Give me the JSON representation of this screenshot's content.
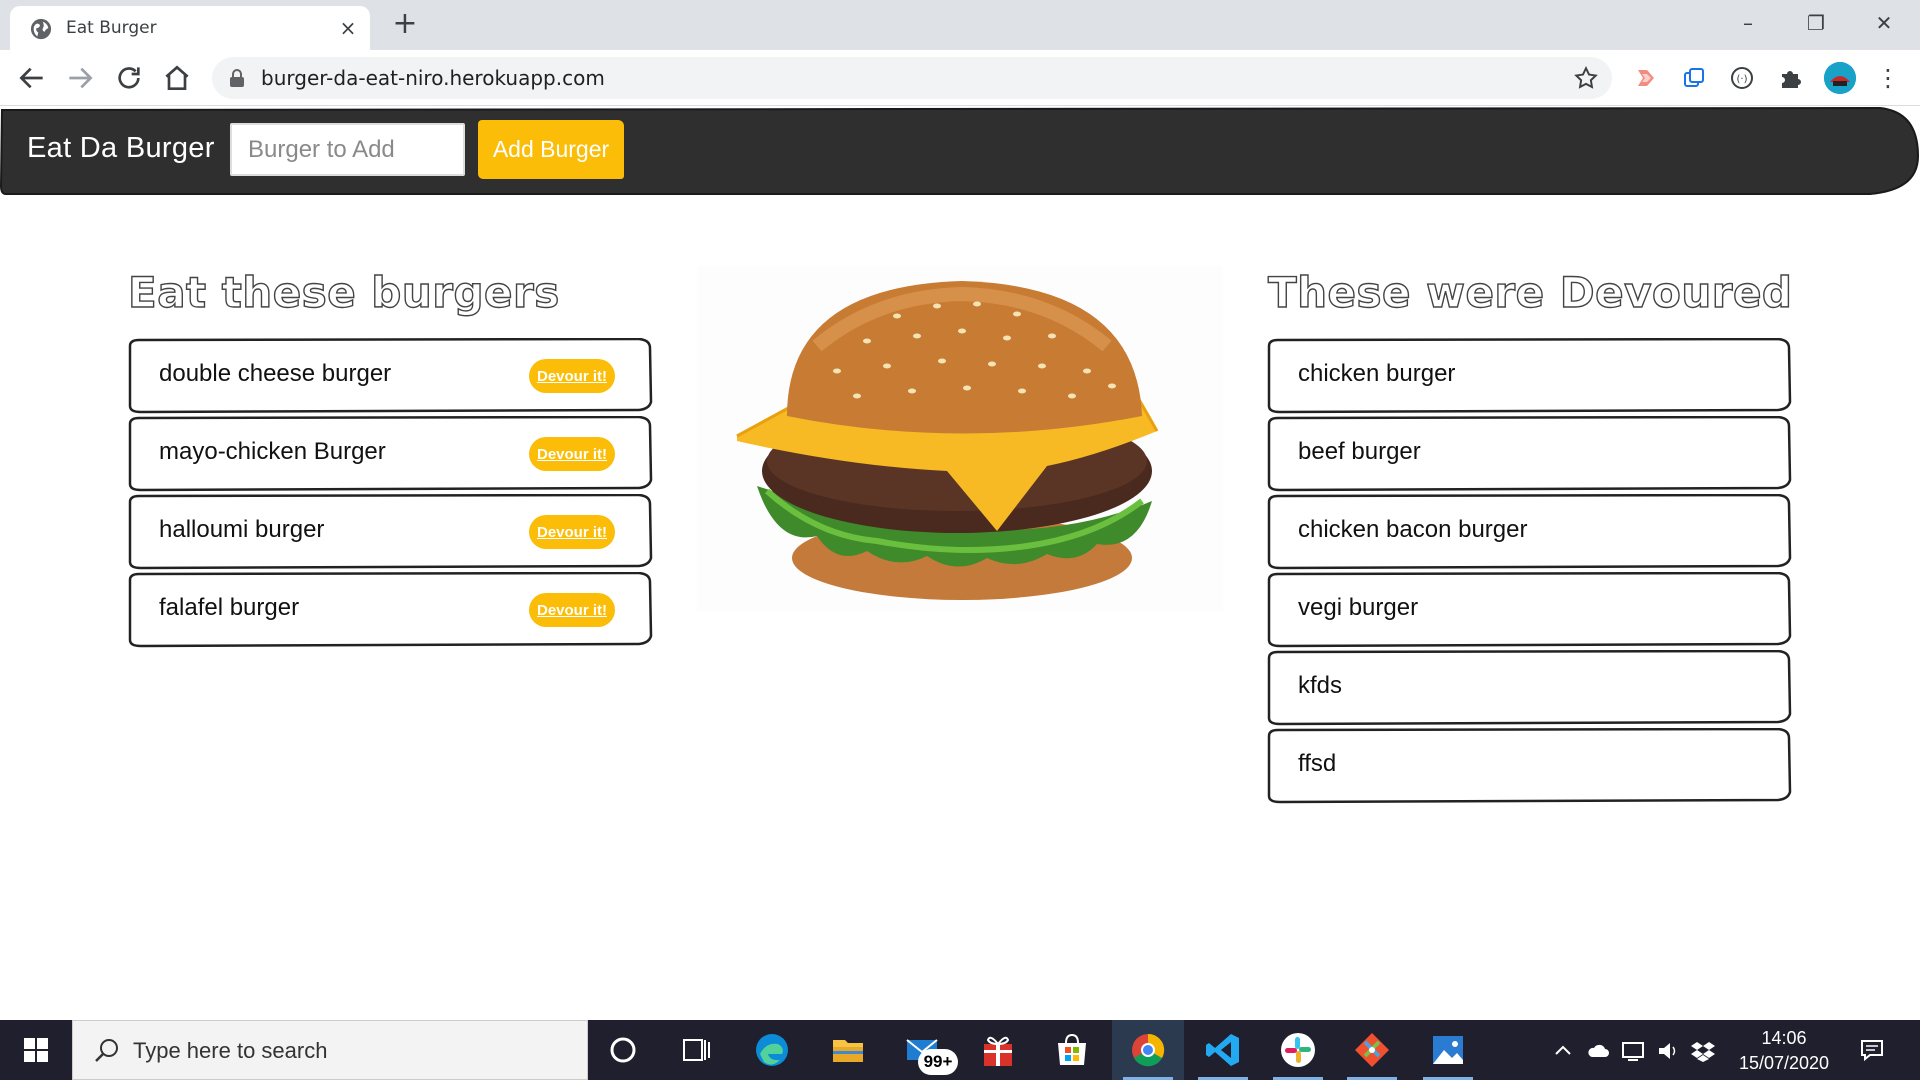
{
  "browser": {
    "tab_title": "Eat Burger",
    "url": "burger-da-eat-niro.herokuapp.com",
    "new_tab_glyph": "+",
    "close_glyph": "×",
    "minimize_glyph": "–",
    "restore_glyph": "❐",
    "window_close_glyph": "✕",
    "menu_glyph": "⋮"
  },
  "navbar": {
    "brand": "Eat Da Burger",
    "input_placeholder": "Burger to Add",
    "add_button": "Add Burger"
  },
  "left_column": {
    "heading": "Eat these burgers",
    "items": [
      {
        "name": "double cheese burger",
        "action": "Devour it!"
      },
      {
        "name": "mayo-chicken Burger",
        "action": "Devour it!"
      },
      {
        "name": "halloumi burger",
        "action": "Devour it!"
      },
      {
        "name": "falafel burger",
        "action": "Devour it!"
      }
    ]
  },
  "right_column": {
    "heading": "These were Devoured",
    "items": [
      {
        "name": "chicken burger"
      },
      {
        "name": "beef burger"
      },
      {
        "name": "chicken bacon burger"
      },
      {
        "name": "vegi burger"
      },
      {
        "name": "kfds"
      },
      {
        "name": "ffsd"
      }
    ]
  },
  "taskbar": {
    "search_placeholder": "Type here to search",
    "mail_badge": "99+",
    "time": "14:06",
    "date": "15/07/2020"
  },
  "colors": {
    "navbar": "#2f2f2f",
    "accent_yellow": "#fbbd08",
    "card_border": "#222222"
  },
  "icons": [
    "globe-icon",
    "back-icon",
    "forward-icon",
    "reload-icon",
    "home-icon",
    "lock-icon",
    "star-icon",
    "extension-icon",
    "puzzle-icon",
    "windows-icon",
    "search-icon",
    "cortana-icon",
    "task-view-icon",
    "edge-icon",
    "file-explorer-icon",
    "mail-icon",
    "gift-icon",
    "store-icon",
    "chrome-icon",
    "vscode-icon",
    "slack-icon",
    "git-icon",
    "photos-icon",
    "cloud-icon",
    "speaker-icon",
    "dropbox-icon",
    "notification-icon"
  ]
}
